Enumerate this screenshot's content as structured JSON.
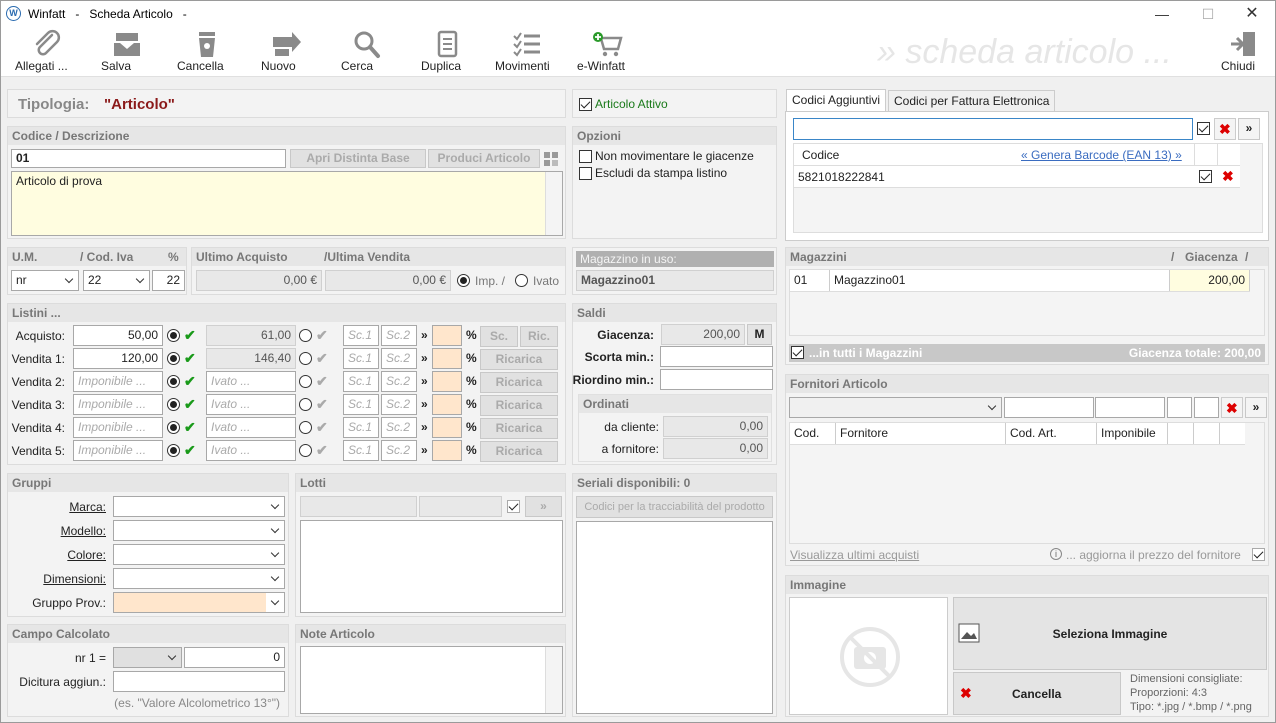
{
  "window": {
    "app": "Winfatt",
    "sep1": "-",
    "title": "Scheda Articolo",
    "sep2": "-",
    "minimize": "—",
    "maximize": "☐",
    "close": "✕"
  },
  "toolbar": {
    "buttons": [
      {
        "label": "Allegati ...",
        "icon": "paperclip-icon"
      },
      {
        "label": "Salva",
        "icon": "save-icon"
      },
      {
        "label": "Cancella",
        "icon": "trash-icon"
      },
      {
        "label": "Nuovo",
        "icon": "new-arrow-icon"
      },
      {
        "label": "Cerca",
        "icon": "search-icon"
      },
      {
        "label": "Duplica",
        "icon": "duplicate-icon"
      },
      {
        "label": "Movimenti",
        "icon": "list-icon"
      },
      {
        "label": "e-Winfatt",
        "icon": "cart-icon"
      }
    ],
    "watermark": "» scheda articolo ...",
    "close_label": "Chiudi"
  },
  "tipologia": {
    "label": "Tipologia:",
    "value": "\"Articolo\""
  },
  "attivo": {
    "label": "Articolo Attivo",
    "checked": true
  },
  "codice": {
    "header_codice": "Codice",
    "header_sep": "/",
    "header_descr": "Descrizione",
    "value": "01",
    "apri_label": "Apri Distinta Base",
    "produci_label": "Produci Articolo",
    "descrizione": "Articolo di prova"
  },
  "opzioni": {
    "header": "Opzioni",
    "opt1": "Non movimentare le giacenze",
    "opt2": "Escludi da stampa listino"
  },
  "um": {
    "h_um": "U.M.",
    "h_iva": "/ Cod. Iva",
    "h_pct": "%",
    "um_value": "nr",
    "iva_value": "22",
    "pct_value": "22"
  },
  "ultimo": {
    "h_acq": "Ultimo Acquisto",
    "h_vend": "/Ultima Vendita",
    "acq": "0,00 €",
    "vend": "0,00 €",
    "imp": "Imp. /",
    "ivato": "Ivato"
  },
  "magazzino_uso": {
    "header": "Magazzino in uso:",
    "value": "Magazzino01"
  },
  "listini": {
    "header": "Listini ...",
    "rows": [
      {
        "label": "Acquisto:",
        "imponibile": "50,00",
        "ivato": "61,00",
        "btn1": "Sc.",
        "btn2": "Ric."
      },
      {
        "label": "Vendita 1:",
        "imponibile": "120,00",
        "ivato": "146,40",
        "btn1": "Ricarica"
      },
      {
        "label": "Vendita 2:",
        "imponibile": "Imponibile ...",
        "ivato": "Ivato ...",
        "btn1": "Ricarica"
      },
      {
        "label": "Vendita 3:",
        "imponibile": "Imponibile ...",
        "ivato": "Ivato ...",
        "btn1": "Ricarica"
      },
      {
        "label": "Vendita 4:",
        "imponibile": "Imponibile ...",
        "ivato": "Ivato ...",
        "btn1": "Ricarica"
      },
      {
        "label": "Vendita 5:",
        "imponibile": "Imponibile ...",
        "ivato": "Ivato ...",
        "btn1": "Ricarica"
      }
    ],
    "sc1": "Sc.1",
    "sc2": "Sc.2",
    "arrow": "»",
    "pct": "%"
  },
  "saldi": {
    "header": "Saldi",
    "giacenza_label": "Giacenza:",
    "giacenza": "200,00",
    "m_label": "M",
    "scorta_label": "Scorta min.:",
    "riordino_label": "Riordino min.:",
    "ordinati_header": "Ordinati",
    "cliente_label": "da cliente:",
    "cliente": "0,00",
    "fornitore_label": "a fornitore:",
    "fornitore": "0,00"
  },
  "gruppi": {
    "header": "Gruppi",
    "marca": "Marca:",
    "modello": "Modello:",
    "colore": "Colore:",
    "dimensioni": "Dimensioni:",
    "gruppo_prov": "Gruppo Prov.:"
  },
  "lotti": {
    "header": "Lotti",
    "arrow": "»"
  },
  "seriali": {
    "header": "Seriali disponibili: 0",
    "btn": "Codici per la tracciabilità del prodotto"
  },
  "campo": {
    "header": "Campo Calcolato",
    "nr_label": "nr 1 =",
    "nr_value": "0",
    "dicitura_label": "Dicitura aggiun.:",
    "hint": "(es. \"Valore Alcolometrico 13°\")"
  },
  "note": {
    "header": "Note Articolo"
  },
  "codici": {
    "tab1": "Codici Aggiuntivi",
    "tab2": "Codici per Fattura Elettronica",
    "col_codice": "Codice",
    "genera": "« Genera Barcode (EAN 13) »",
    "row_value": "5821018222841",
    "arrow": "»"
  },
  "magazzini": {
    "header": "Magazzini",
    "h_sep": "/",
    "h_giac": "Giacenza",
    "h_sep2": "/",
    "row_cod": "01",
    "row_nome": "Magazzino01",
    "row_giac": "200,00",
    "tutti": "...in tutti i Magazzini",
    "totale": "Giacenza totale: 200,00"
  },
  "fornitori": {
    "header": "Fornitori Articolo",
    "col_cod": "Cod.",
    "col_forn": "Fornitore",
    "col_art": "Cod. Art.",
    "col_imp": "Imponibile",
    "arrow": "»",
    "visualizza": "Visualizza ultimi acquisti",
    "aggiorna": "... aggiorna il prezzo del fornitore"
  },
  "immagine": {
    "header": "Immagine",
    "seleziona": "Seleziona Immagine",
    "cancella": "Cancella",
    "dim1": "Dimensioni consigliate:",
    "dim2": "Proporzioni: 4:3",
    "dim3": "Tipo: *.jpg / *.bmp / *.png"
  }
}
